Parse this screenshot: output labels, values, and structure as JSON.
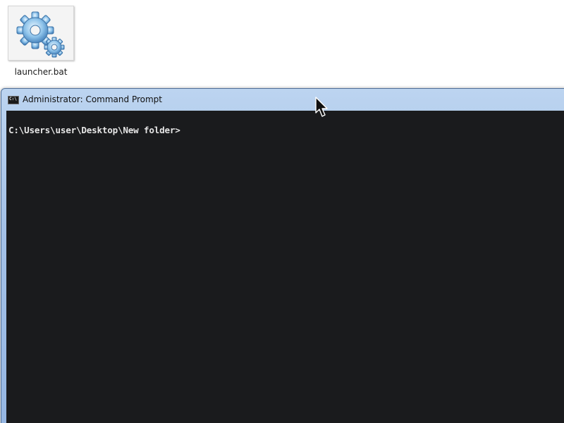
{
  "desktop": {
    "file": {
      "name": "launcher.bat",
      "icon": "batch-file-gears-icon"
    }
  },
  "window": {
    "title": "Administrator: Command Prompt",
    "icon": "cmd-icon",
    "icon_text": "C:\\",
    "console": {
      "prompt": "C:\\Users\\user\\Desktop\\New folder>",
      "background": "#1a1b1d",
      "foreground": "#e6e6e6"
    }
  },
  "pointer": {
    "icon": "mouse-pointer-icon"
  }
}
